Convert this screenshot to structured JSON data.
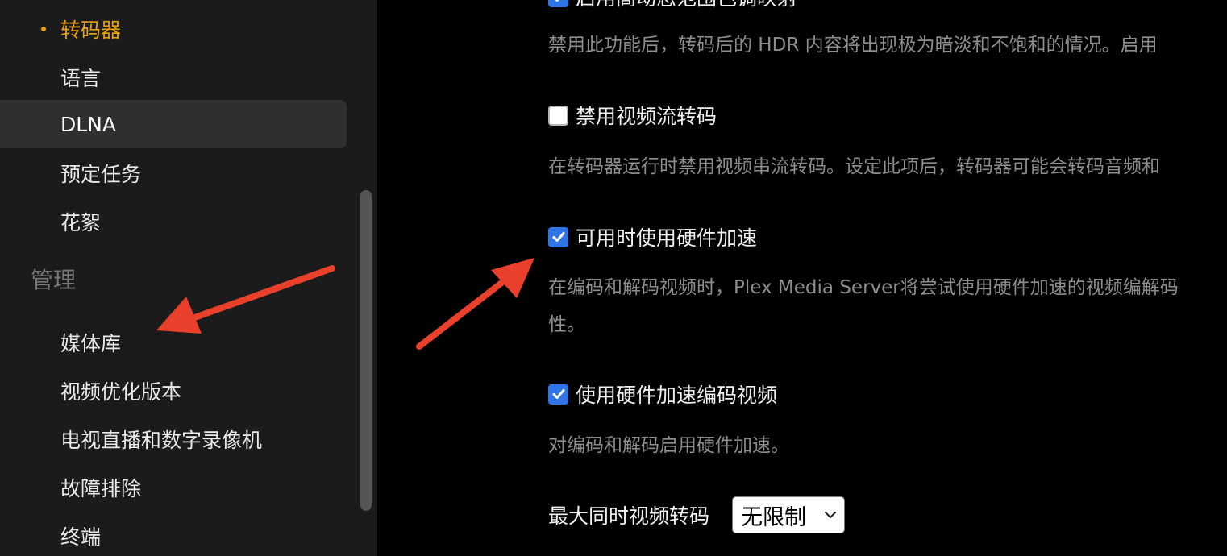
{
  "sidebar": {
    "items": [
      {
        "label": "转码器"
      },
      {
        "label": "语言"
      },
      {
        "label": "DLNA"
      },
      {
        "label": "预定任务"
      },
      {
        "label": "花絮"
      }
    ],
    "section_header": "管理",
    "manage_items": [
      {
        "label": "媒体库"
      },
      {
        "label": "视频优化版本"
      },
      {
        "label": "电视直播和数字录像机"
      },
      {
        "label": "故障排除"
      },
      {
        "label": "终端"
      }
    ]
  },
  "main": {
    "top_partial_label": "启用高动态范围色调映射",
    "top_desc": "禁用此功能后，转码后的 HDR 内容将出现极为暗淡和不饱和的情况。启用",
    "options": [
      {
        "label": "禁用视频流转码",
        "checked": false,
        "desc": [
          "在转码器运行时禁用视频串流转码。设定此项后，转码器可能会转码音频和"
        ]
      },
      {
        "label": "可用时使用硬件加速",
        "checked": true,
        "desc": [
          "在编码和解码视频时，Plex Media Server将尝试使用硬件加速的视频编解码",
          "性。"
        ]
      },
      {
        "label": "使用硬件加速编码视频",
        "checked": true,
        "desc": [
          "对编码和解码启用硬件加速。"
        ]
      }
    ],
    "max_transcode": {
      "label": "最大同时视频转码",
      "value": "无限制"
    }
  },
  "colors": {
    "accent": "#e5a00d",
    "checkbox_checked": "#2f75e8",
    "arrow": "#e8402b"
  }
}
